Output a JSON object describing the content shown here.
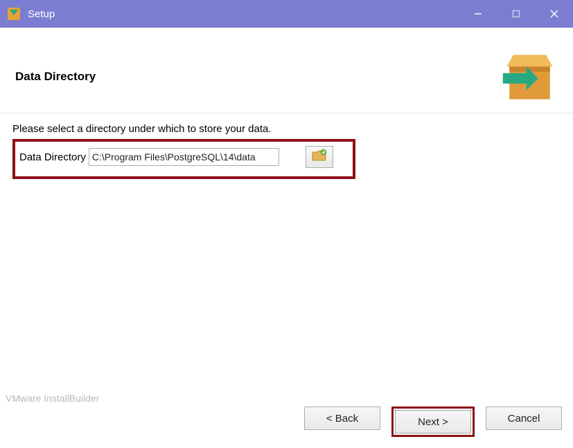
{
  "titlebar": {
    "title": "Setup"
  },
  "page": {
    "title": "Data Directory",
    "instruction": "Please select a directory under which to store your data.",
    "field_label": "Data Directory",
    "field_value": "C:\\Program Files\\PostgreSQL\\14\\data",
    "builder_text": "VMware InstallBuilder"
  },
  "buttons": {
    "back": "< Back",
    "next": "Next >",
    "cancel": "Cancel"
  }
}
